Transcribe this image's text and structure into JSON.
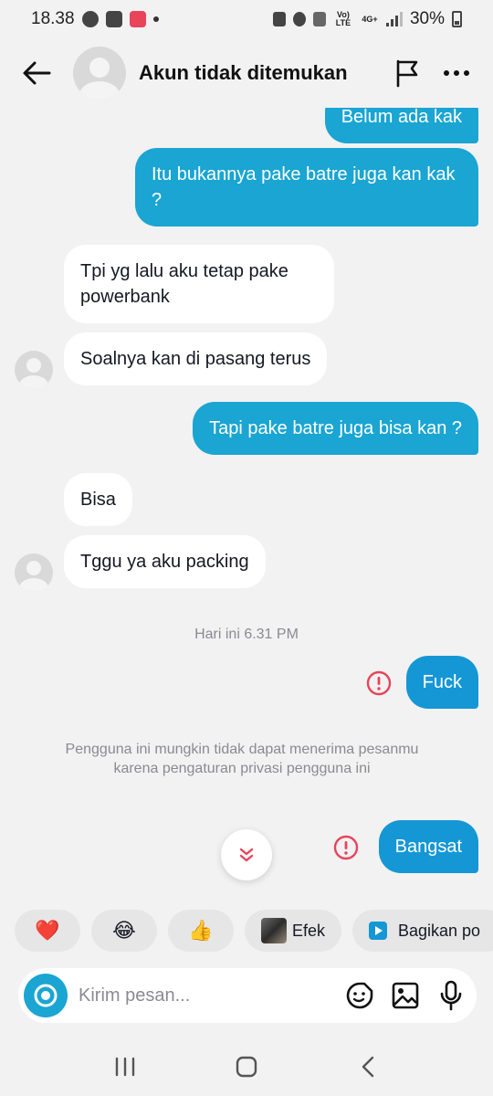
{
  "status_bar": {
    "time": "18.38",
    "network": "Vo) LTE",
    "network_type": "4G+",
    "battery": "30%"
  },
  "header": {
    "title": "Akun tidak ditemukan"
  },
  "messages": [
    {
      "text": "Belum ada kak",
      "direction": "out"
    },
    {
      "text": "Itu bukannya pake batre juga kan kak ?",
      "direction": "out"
    },
    {
      "text": "Tpi yg lalu aku tetap pake powerbank",
      "direction": "in"
    },
    {
      "text": "Soalnya kan di pasang terus",
      "direction": "in"
    },
    {
      "text": "Tapi pake batre juga bisa kan ?",
      "direction": "out"
    },
    {
      "text": "Bisa",
      "direction": "in"
    },
    {
      "text": "Tggu ya aku packing",
      "direction": "in"
    },
    {
      "text": "Fuck",
      "direction": "out",
      "status": "failed"
    },
    {
      "text": "Bangsat",
      "direction": "out",
      "status": "failed"
    }
  ],
  "timestamp": "Hari ini 6.31 PM",
  "privacy_notice": "Pengguna ini mungkin tidak dapat menerima pesanmu karena pengaturan privasi pengguna ini",
  "quick_replies": {
    "heart": "❤️",
    "laugh": "😂",
    "thumbs": "👍",
    "effect_label": "Efek",
    "share_label": "Bagikan po"
  },
  "composer": {
    "placeholder": "Kirim pesan..."
  },
  "colors": {
    "outgoing_bubble": "#1aa5d3",
    "error_red": "#e8445a",
    "background": "#f2f2f2"
  }
}
